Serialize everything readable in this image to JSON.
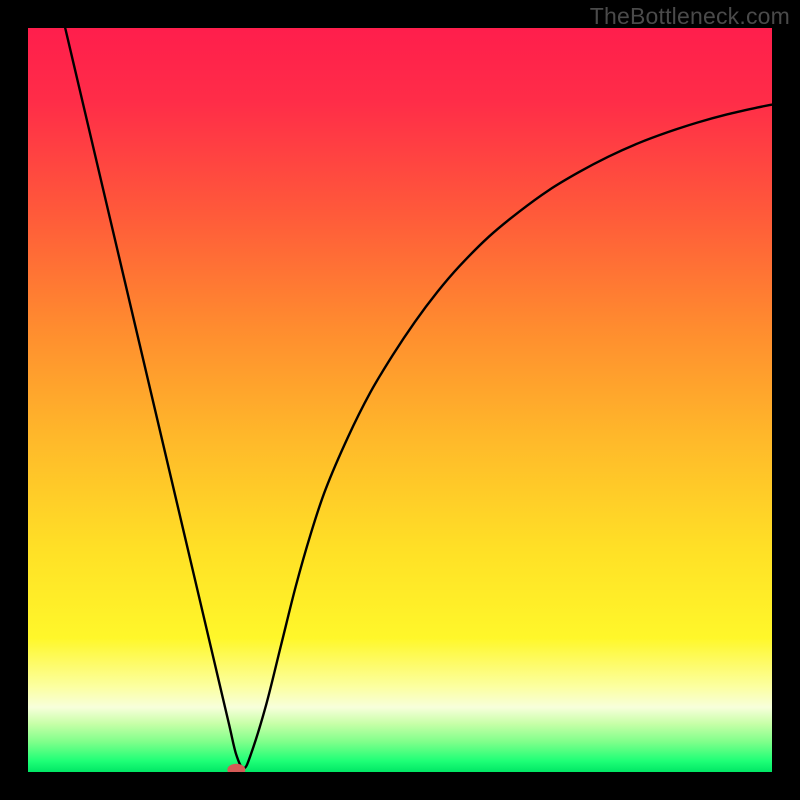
{
  "watermark": "TheBottleneck.com",
  "chart_data": {
    "type": "line",
    "title": "",
    "xlabel": "",
    "ylabel": "",
    "xlim": [
      0,
      100
    ],
    "ylim": [
      0,
      100
    ],
    "gradient_stops": [
      {
        "offset": 0,
        "color": "#ff1e4c"
      },
      {
        "offset": 0.1,
        "color": "#ff2d48"
      },
      {
        "offset": 0.25,
        "color": "#ff5a3a"
      },
      {
        "offset": 0.4,
        "color": "#ff8b2f"
      },
      {
        "offset": 0.55,
        "color": "#ffb82a"
      },
      {
        "offset": 0.7,
        "color": "#ffe026"
      },
      {
        "offset": 0.82,
        "color": "#fff72a"
      },
      {
        "offset": 0.885,
        "color": "#fcffa0"
      },
      {
        "offset": 0.913,
        "color": "#f7ffdb"
      },
      {
        "offset": 0.935,
        "color": "#c8ffa8"
      },
      {
        "offset": 0.96,
        "color": "#7eff8a"
      },
      {
        "offset": 0.985,
        "color": "#1fff77"
      },
      {
        "offset": 1.0,
        "color": "#00e765"
      }
    ],
    "series": [
      {
        "name": "bottleneck-curve",
        "x": [
          5,
          7,
          9,
          11,
          13,
          15,
          17,
          19,
          21,
          23,
          25,
          27,
          28,
          29,
          30,
          32,
          34,
          36,
          38,
          40,
          43,
          46,
          49,
          52,
          55,
          58,
          62,
          66,
          70,
          74,
          78,
          82,
          86,
          90,
          94,
          98,
          100
        ],
        "y": [
          100,
          91.5,
          83,
          74.5,
          66,
          57.5,
          49,
          40.5,
          32,
          23.5,
          15,
          6.5,
          2.3,
          0.5,
          2.5,
          9,
          17,
          25,
          32,
          38,
          45,
          51,
          56,
          60.5,
          64.5,
          68,
          72,
          75.3,
          78.2,
          80.6,
          82.7,
          84.5,
          86.0,
          87.3,
          88.4,
          89.3,
          89.7
        ]
      }
    ],
    "marker": {
      "name": "optimal-point",
      "x": 28,
      "y": 0.3,
      "color": "#d45a56",
      "rx": 9,
      "ry": 6
    }
  }
}
